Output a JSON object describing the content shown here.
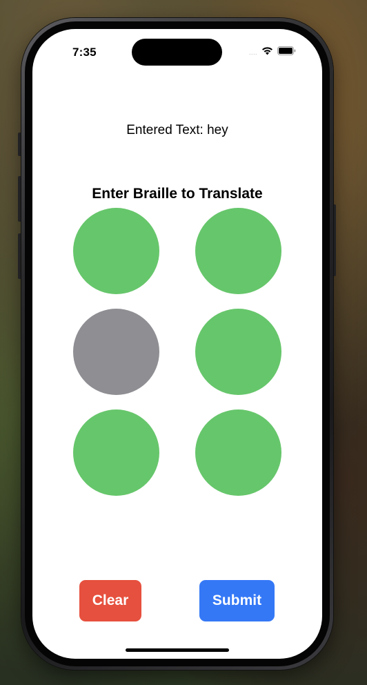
{
  "status_bar": {
    "time": "7:35",
    "signal_text": "....",
    "wifi_icon": "wifi-icon",
    "battery_icon": "battery-icon"
  },
  "entered_text": "Entered Text: hey",
  "heading": "Enter Braille to Translate",
  "braille_cells": [
    {
      "position": 1,
      "state": "on"
    },
    {
      "position": 4,
      "state": "on"
    },
    {
      "position": 2,
      "state": "off"
    },
    {
      "position": 5,
      "state": "on"
    },
    {
      "position": 3,
      "state": "on"
    },
    {
      "position": 6,
      "state": "on"
    }
  ],
  "colors": {
    "dot_on": "#66c66b",
    "dot_off": "#8e8e93",
    "clear_button": "#e6503e",
    "submit_button": "#3478f6"
  },
  "buttons": {
    "clear_label": "Clear",
    "submit_label": "Submit"
  }
}
